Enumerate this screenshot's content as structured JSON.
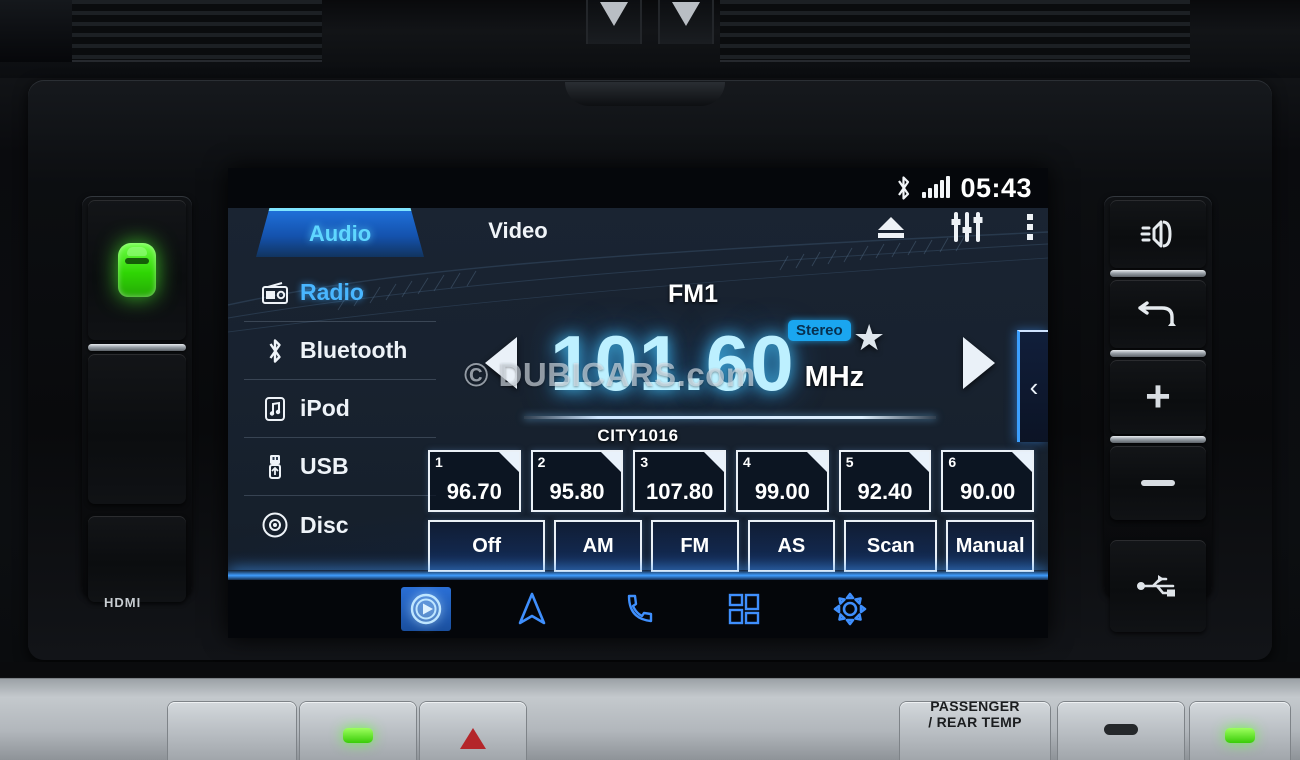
{
  "status_bar": {
    "bluetooth_icon": "bluetooth-icon",
    "signal_icon": "signal-bars-icon",
    "time": "05:43"
  },
  "tabs": [
    {
      "label": "Audio",
      "active": true
    },
    {
      "label": "Video",
      "active": false
    }
  ],
  "top_actions": [
    {
      "name": "eject-icon",
      "label": "Eject"
    },
    {
      "name": "equalizer-icon",
      "label": "Sound settings"
    },
    {
      "name": "more-options-icon",
      "label": "More"
    }
  ],
  "sidebar": {
    "items": [
      {
        "label": "Radio",
        "icon": "radio-icon",
        "active": true
      },
      {
        "label": "Bluetooth",
        "icon": "bluetooth-icon",
        "active": false
      },
      {
        "label": "iPod",
        "icon": "ipod-icon",
        "active": false
      },
      {
        "label": "USB",
        "icon": "usb-icon",
        "active": false
      },
      {
        "label": "Disc",
        "icon": "disc-icon",
        "active": false
      }
    ]
  },
  "radio": {
    "band": "FM1",
    "frequency": "101.60",
    "unit": "MHz",
    "stereo_badge": "Stereo",
    "favorite_icon": "star-icon",
    "station_name": "CITY1016",
    "prev_icon": "previous-station-icon",
    "next_icon": "next-station-icon",
    "presets": [
      {
        "number": "1",
        "value": "96.70"
      },
      {
        "number": "2",
        "value": "95.80"
      },
      {
        "number": "3",
        "value": "107.80"
      },
      {
        "number": "4",
        "value": "99.00"
      },
      {
        "number": "5",
        "value": "92.40"
      },
      {
        "number": "6",
        "value": "90.00"
      }
    ],
    "modes": [
      {
        "label": "Off"
      },
      {
        "label": "AM"
      },
      {
        "label": "FM"
      },
      {
        "label": "AS"
      },
      {
        "label": "Scan"
      },
      {
        "label": "Manual"
      }
    ]
  },
  "side_drawer": {
    "chevron": "‹"
  },
  "bottom_nav": [
    {
      "name": "media-icon",
      "label": "Media",
      "active": true
    },
    {
      "name": "navigation-icon",
      "label": "Navigation",
      "active": false
    },
    {
      "name": "phone-icon",
      "label": "Phone",
      "active": false
    },
    {
      "name": "apps-icon",
      "label": "Apps",
      "active": false
    },
    {
      "name": "settings-gear-icon",
      "label": "Setup",
      "active": false
    }
  ],
  "watermark": "© DUBICARS.com",
  "bezel": {
    "left": {
      "car_button": "vehicle-status-icon",
      "hdmi_label": "HDMI"
    },
    "right": {
      "voice_button": "voice-command-icon",
      "back_home_button": "back-home-icon",
      "volume_up": "+",
      "volume_down": "−",
      "usb_label": "usb-icon"
    }
  },
  "climate": {
    "passenger_temp_label": "PASSENGER\n/ REAR TEMP",
    "passenger_temp_line1": "PASSENGER",
    "passenger_temp_line2": "/ REAR TEMP"
  },
  "colors": {
    "accent_cyan": "#5fd7ff",
    "accent_blue": "#2f7ffb",
    "freq_glow": "#bdf0ff",
    "stereo_bg": "#1aa6f0",
    "led_green": "#39cc08"
  }
}
